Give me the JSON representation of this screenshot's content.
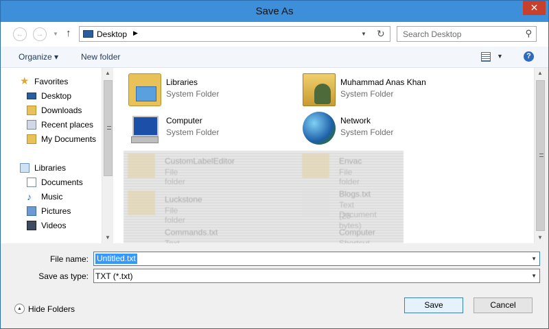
{
  "window": {
    "title": "Save As",
    "close_glyph": "✕"
  },
  "navbar": {
    "back_glyph": "←",
    "forward_glyph": "→",
    "recent_glyph": "▼",
    "up_glyph": "↑",
    "address": "Desktop",
    "crumb_glyph": "▶",
    "address_drop_glyph": "▼",
    "refresh_glyph": "↻",
    "search_placeholder": "Search Desktop",
    "search_glyph": "⚲"
  },
  "toolbar": {
    "organize": "Organize ▾",
    "new_folder": "New folder",
    "view_drop_glyph": "▼",
    "help_glyph": "?"
  },
  "navpane": {
    "favorites": "Favorites",
    "desktop": "Desktop",
    "downloads": "Downloads",
    "recent_places": "Recent places",
    "my_documents": "My Documents",
    "libraries": "Libraries",
    "documents": "Documents",
    "music": "Music",
    "pictures": "Pictures",
    "videos": "Videos",
    "star_glyph": "★",
    "music_glyph": "♪"
  },
  "scroll": {
    "up_glyph": "▲",
    "down_glyph": "▼"
  },
  "content": {
    "items": [
      {
        "name": "Libraries",
        "type": "System Folder"
      },
      {
        "name": "Muhammad Anas Khan",
        "type": "System Folder"
      },
      {
        "name": "Computer",
        "type": "System Folder"
      },
      {
        "name": "Network",
        "type": "System Folder"
      },
      {
        "name": "CustomLabelEditor",
        "type": "File folder"
      },
      {
        "name": "Envac",
        "type": "File folder"
      },
      {
        "name": "Luckstone",
        "type": "File folder"
      },
      {
        "name": "Blogs.txt",
        "type": "Text Document",
        "size": "(25 bytes)"
      },
      {
        "name": "Commands.txt",
        "type": "Text Document"
      },
      {
        "name": "Computer",
        "type": "Shortcut"
      }
    ]
  },
  "bottom": {
    "file_name_label": "File name:",
    "file_name_value": "Untitled.txt",
    "save_type_label": "Save as type:",
    "save_type_value": "TXT (*.txt)",
    "combo_drop_glyph": "▼",
    "hide_folders": "Hide Folders",
    "hide_glyph": "▲",
    "save": "Save",
    "cancel": "Cancel"
  }
}
